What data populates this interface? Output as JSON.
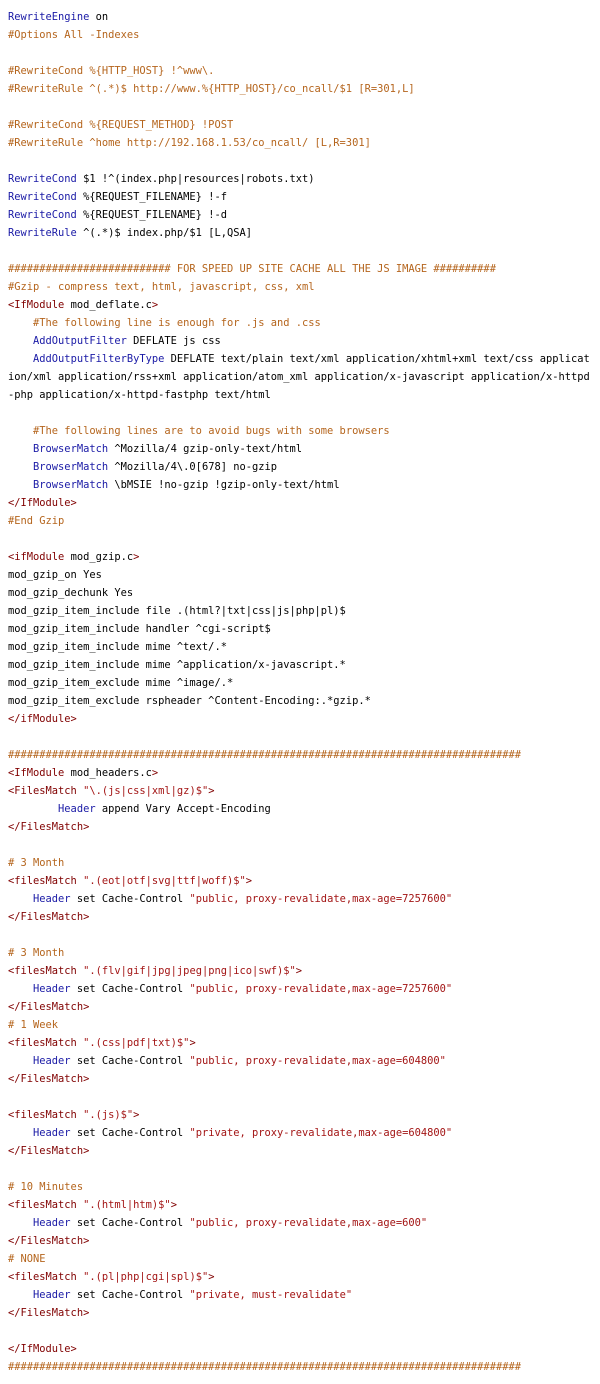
{
  "document": {
    "type": "htaccess-source",
    "colors": {
      "keyword": "#1a1aa6",
      "comment": "#b5651d",
      "tag": "#800000",
      "string": "#a31515",
      "plain": "#000000"
    },
    "lines": [
      [
        {
          "t": "kw",
          "v": "RewriteEngine"
        },
        {
          "t": "pl",
          "v": " on"
        }
      ],
      [
        {
          "t": "cm",
          "v": "#Options All -Indexes"
        }
      ],
      [],
      [
        {
          "t": "cm",
          "v": "#RewriteCond %{HTTP_HOST} !^www\\."
        }
      ],
      [
        {
          "t": "cm",
          "v": "#RewriteRule ^(.*)$ http://www.%{HTTP_HOST}/co_ncall/$1 [R=301,L]"
        }
      ],
      [],
      [
        {
          "t": "cm",
          "v": "#RewriteCond %{REQUEST_METHOD} !POST"
        }
      ],
      [
        {
          "t": "cm",
          "v": "#RewriteRule ^home http://192.168.1.53/co_ncall/ [L,R=301]"
        }
      ],
      [],
      [
        {
          "t": "kw",
          "v": "RewriteCond"
        },
        {
          "t": "pl",
          "v": " $1 !^(index.php|resources|robots.txt)"
        }
      ],
      [
        {
          "t": "kw",
          "v": "RewriteCond"
        },
        {
          "t": "pl",
          "v": " %{REQUEST_FILENAME} !-f"
        }
      ],
      [
        {
          "t": "kw",
          "v": "RewriteCond"
        },
        {
          "t": "pl",
          "v": " %{REQUEST_FILENAME} !-d"
        }
      ],
      [
        {
          "t": "kw",
          "v": "RewriteRule"
        },
        {
          "t": "pl",
          "v": " ^(.*)$ index.php/$1 [L,QSA]"
        }
      ],
      [],
      [
        {
          "t": "cm",
          "v": "########################## FOR SPEED UP SITE CACHE ALL THE JS IMAGE ##########"
        }
      ],
      [
        {
          "t": "cm",
          "v": "#Gzip - compress text, html, javascript, css, xml"
        }
      ],
      [
        {
          "t": "tag",
          "v": "<IfModule"
        },
        {
          "t": "pl",
          "v": " mod_deflate.c"
        },
        {
          "t": "tag",
          "v": ">"
        }
      ],
      [
        {
          "t": "pl",
          "v": "    "
        },
        {
          "t": "cm",
          "v": "#The following line is enough for .js and .css"
        }
      ],
      [
        {
          "t": "pl",
          "v": "    "
        },
        {
          "t": "kw",
          "v": "AddOutputFilter"
        },
        {
          "t": "pl",
          "v": " DEFLATE js css"
        }
      ],
      [
        {
          "t": "pl",
          "v": "    "
        },
        {
          "t": "kw",
          "v": "AddOutputFilterByType"
        },
        {
          "t": "pl",
          "v": " DEFLATE text/plain text/xml application/xhtml+xml text/css application/xml application/rss+xml application/atom_xml application/x-javascript application/x-httpd-php application/x-httpd-fastphp text/html"
        }
      ],
      [],
      [
        {
          "t": "pl",
          "v": "    "
        },
        {
          "t": "cm",
          "v": "#The following lines are to avoid bugs with some browsers"
        }
      ],
      [
        {
          "t": "pl",
          "v": "    "
        },
        {
          "t": "kw",
          "v": "BrowserMatch"
        },
        {
          "t": "pl",
          "v": " ^Mozilla/4 gzip-only-text/html"
        }
      ],
      [
        {
          "t": "pl",
          "v": "    "
        },
        {
          "t": "kw",
          "v": "BrowserMatch"
        },
        {
          "t": "pl",
          "v": " ^Mozilla/4\\.0[678] no-gzip"
        }
      ],
      [
        {
          "t": "pl",
          "v": "    "
        },
        {
          "t": "kw",
          "v": "BrowserMatch"
        },
        {
          "t": "pl",
          "v": " \\bMSIE !no-gzip !gzip-only-text/html"
        }
      ],
      [
        {
          "t": "tag",
          "v": "</IfModule>"
        }
      ],
      [
        {
          "t": "cm",
          "v": "#End Gzip"
        }
      ],
      [],
      [
        {
          "t": "tag",
          "v": "<ifModule"
        },
        {
          "t": "pl",
          "v": " mod_gzip.c"
        },
        {
          "t": "tag",
          "v": ">"
        }
      ],
      [
        {
          "t": "pl",
          "v": "mod_gzip_on Yes"
        }
      ],
      [
        {
          "t": "pl",
          "v": "mod_gzip_dechunk Yes"
        }
      ],
      [
        {
          "t": "pl",
          "v": "mod_gzip_item_include file .(html?|txt|css|js|php|pl)$"
        }
      ],
      [
        {
          "t": "pl",
          "v": "mod_gzip_item_include handler ^cgi-script$"
        }
      ],
      [
        {
          "t": "pl",
          "v": "mod_gzip_item_include mime ^text/.*"
        }
      ],
      [
        {
          "t": "pl",
          "v": "mod_gzip_item_include mime ^application/x-javascript.*"
        }
      ],
      [
        {
          "t": "pl",
          "v": "mod_gzip_item_exclude mime ^image/.*"
        }
      ],
      [
        {
          "t": "pl",
          "v": "mod_gzip_item_exclude rspheader ^Content-Encoding:.*gzip.*"
        }
      ],
      [
        {
          "t": "tag",
          "v": "</ifModule>"
        }
      ],
      [],
      [
        {
          "t": "cm",
          "v": "##################################################################################"
        }
      ],
      [
        {
          "t": "tag",
          "v": "<IfModule"
        },
        {
          "t": "pl",
          "v": " mod_headers.c"
        },
        {
          "t": "tag",
          "v": ">"
        }
      ],
      [
        {
          "t": "tag",
          "v": "<FilesMatch"
        },
        {
          "t": "pl",
          "v": " "
        },
        {
          "t": "str",
          "v": "\"\\.(js|css|xml|gz)$\""
        },
        {
          "t": "tag",
          "v": ">"
        }
      ],
      [
        {
          "t": "pl",
          "v": "        "
        },
        {
          "t": "kw",
          "v": "Header"
        },
        {
          "t": "pl",
          "v": " append Vary Accept-Encoding"
        }
      ],
      [
        {
          "t": "tag",
          "v": "</FilesMatch>"
        }
      ],
      [],
      [
        {
          "t": "cm",
          "v": "# 3 Month"
        }
      ],
      [
        {
          "t": "tag",
          "v": "<filesMatch"
        },
        {
          "t": "pl",
          "v": " "
        },
        {
          "t": "str",
          "v": "\".(eot|otf|svg|ttf|woff)$\""
        },
        {
          "t": "tag",
          "v": ">"
        }
      ],
      [
        {
          "t": "pl",
          "v": "    "
        },
        {
          "t": "kw",
          "v": "Header"
        },
        {
          "t": "pl",
          "v": " set Cache-Control "
        },
        {
          "t": "str",
          "v": "\"public, proxy-revalidate,max-age=7257600\""
        }
      ],
      [
        {
          "t": "tag",
          "v": "</FilesMatch>"
        }
      ],
      [],
      [
        {
          "t": "cm",
          "v": "# 3 Month"
        }
      ],
      [
        {
          "t": "tag",
          "v": "<filesMatch"
        },
        {
          "t": "pl",
          "v": " "
        },
        {
          "t": "str",
          "v": "\".(flv|gif|jpg|jpeg|png|ico|swf)$\""
        },
        {
          "t": "tag",
          "v": ">"
        }
      ],
      [
        {
          "t": "pl",
          "v": "    "
        },
        {
          "t": "kw",
          "v": "Header"
        },
        {
          "t": "pl",
          "v": " set Cache-Control "
        },
        {
          "t": "str",
          "v": "\"public, proxy-revalidate,max-age=7257600\""
        }
      ],
      [
        {
          "t": "tag",
          "v": "</FilesMatch>"
        }
      ],
      [
        {
          "t": "cm",
          "v": "# 1 Week"
        }
      ],
      [
        {
          "t": "tag",
          "v": "<filesMatch"
        },
        {
          "t": "pl",
          "v": " "
        },
        {
          "t": "str",
          "v": "\".(css|pdf|txt)$\""
        },
        {
          "t": "tag",
          "v": ">"
        }
      ],
      [
        {
          "t": "pl",
          "v": "    "
        },
        {
          "t": "kw",
          "v": "Header"
        },
        {
          "t": "pl",
          "v": " set Cache-Control "
        },
        {
          "t": "str",
          "v": "\"public, proxy-revalidate,max-age=604800\""
        }
      ],
      [
        {
          "t": "tag",
          "v": "</FilesMatch>"
        }
      ],
      [],
      [
        {
          "t": "tag",
          "v": "<filesMatch"
        },
        {
          "t": "pl",
          "v": " "
        },
        {
          "t": "str",
          "v": "\".(js)$\""
        },
        {
          "t": "tag",
          "v": ">"
        }
      ],
      [
        {
          "t": "pl",
          "v": "    "
        },
        {
          "t": "kw",
          "v": "Header"
        },
        {
          "t": "pl",
          "v": " set Cache-Control "
        },
        {
          "t": "str",
          "v": "\"private, proxy-revalidate,max-age=604800\""
        }
      ],
      [
        {
          "t": "tag",
          "v": "</FilesMatch>"
        }
      ],
      [],
      [
        {
          "t": "cm",
          "v": "# 10 Minutes"
        }
      ],
      [
        {
          "t": "tag",
          "v": "<filesMatch"
        },
        {
          "t": "pl",
          "v": " "
        },
        {
          "t": "str",
          "v": "\".(html|htm)$\""
        },
        {
          "t": "tag",
          "v": ">"
        }
      ],
      [
        {
          "t": "pl",
          "v": "    "
        },
        {
          "t": "kw",
          "v": "Header"
        },
        {
          "t": "pl",
          "v": " set Cache-Control "
        },
        {
          "t": "str",
          "v": "\"public, proxy-revalidate,max-age=600\""
        }
      ],
      [
        {
          "t": "tag",
          "v": "</FilesMatch>"
        }
      ],
      [
        {
          "t": "cm",
          "v": "# NONE"
        }
      ],
      [
        {
          "t": "tag",
          "v": "<filesMatch"
        },
        {
          "t": "pl",
          "v": " "
        },
        {
          "t": "str",
          "v": "\".(pl|php|cgi|spl)$\""
        },
        {
          "t": "tag",
          "v": ">"
        }
      ],
      [
        {
          "t": "pl",
          "v": "    "
        },
        {
          "t": "kw",
          "v": "Header"
        },
        {
          "t": "pl",
          "v": " set Cache-Control "
        },
        {
          "t": "str",
          "v": "\"private, must-revalidate\""
        }
      ],
      [
        {
          "t": "tag",
          "v": "</FilesMatch>"
        }
      ],
      [],
      [
        {
          "t": "tag",
          "v": "</IfModule>"
        }
      ],
      [
        {
          "t": "cm",
          "v": "##################################################################################"
        }
      ]
    ]
  }
}
